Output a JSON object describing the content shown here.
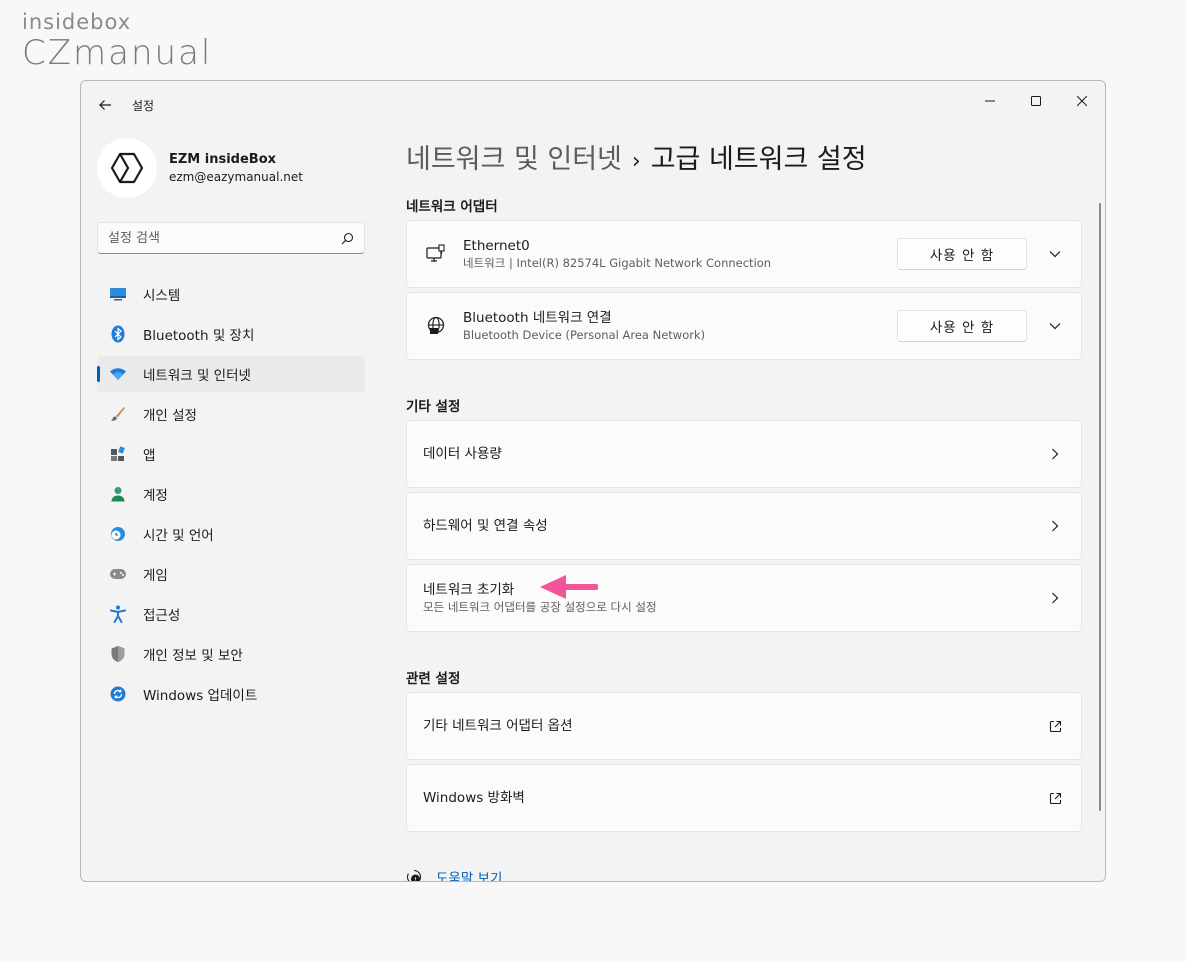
{
  "watermark": {
    "line1": "insidebox",
    "line2": "CZmanual"
  },
  "window": {
    "app_title": "설정"
  },
  "profile": {
    "name": "EZM insideBox",
    "email": "ezm@eazymanual.net"
  },
  "search": {
    "placeholder": "설정 검색"
  },
  "sidebar": {
    "items": [
      {
        "label": "시스템",
        "icon": "system-icon"
      },
      {
        "label": "Bluetooth 및 장치",
        "icon": "bluetooth-icon"
      },
      {
        "label": "네트워크 및 인터넷",
        "icon": "wifi-icon",
        "active": true
      },
      {
        "label": "개인 설정",
        "icon": "brush-icon"
      },
      {
        "label": "앱",
        "icon": "apps-icon"
      },
      {
        "label": "계정",
        "icon": "account-icon"
      },
      {
        "label": "시간 및 언어",
        "icon": "time-language-icon"
      },
      {
        "label": "게임",
        "icon": "gamepad-icon"
      },
      {
        "label": "접근성",
        "icon": "accessibility-icon"
      },
      {
        "label": "개인 정보 및 보안",
        "icon": "shield-icon"
      },
      {
        "label": "Windows 업데이트",
        "icon": "update-icon"
      }
    ]
  },
  "breadcrumb": {
    "parent": "네트워크 및 인터넷",
    "separator": "›",
    "current": "고급 네트워크 설정"
  },
  "adapters": {
    "heading": "네트워크 어댑터",
    "items": [
      {
        "title": "Ethernet0",
        "subtitle": "네트워크 | Intel(R) 82574L Gigabit Network Connection",
        "button": "사용 안 함",
        "icon": "ethernet-icon"
      },
      {
        "title": "Bluetooth 네트워크 연결",
        "subtitle": "Bluetooth Device (Personal Area Network)",
        "button": "사용 안 함",
        "icon": "globe-icon"
      }
    ]
  },
  "other": {
    "heading": "기타 설정",
    "items": [
      {
        "title": "데이터 사용량"
      },
      {
        "title": "하드웨어 및 연결 속성"
      },
      {
        "title": "네트워크 초기화",
        "subtitle": "모든 네트워크 어댑터를 공장 설정으로 다시 설정"
      }
    ]
  },
  "related": {
    "heading": "관련 설정",
    "items": [
      {
        "title": "기타 네트워크 어댑터 옵션"
      },
      {
        "title": "Windows 방화벽"
      }
    ]
  },
  "help": {
    "label": "도움말 보기"
  },
  "colors": {
    "accent": "#005fb8",
    "annotation_arrow": "#f3559b"
  }
}
